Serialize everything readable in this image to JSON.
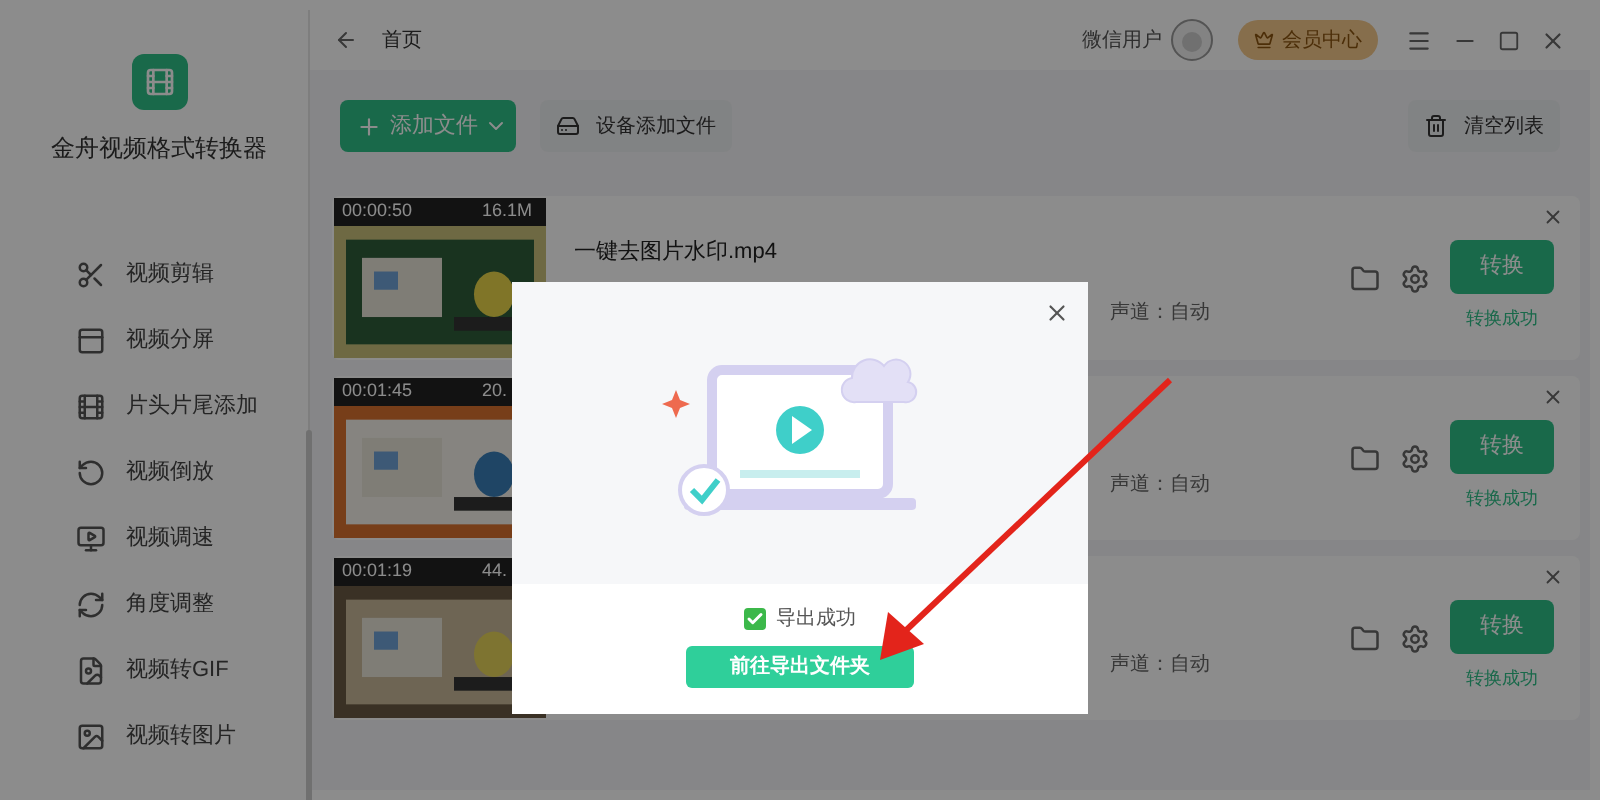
{
  "window": {
    "app_name": "金舟视频格式转换器",
    "breadcrumb": "首页",
    "user": "微信用户",
    "vip_button": "会员中心"
  },
  "sidebar": {
    "items": [
      {
        "label": "视频剪辑"
      },
      {
        "label": "视频分屏"
      },
      {
        "label": "片头片尾添加"
      },
      {
        "label": "视频倒放"
      },
      {
        "label": "视频调速"
      },
      {
        "label": "角度调整"
      },
      {
        "label": "视频转GIF"
      },
      {
        "label": "视频转图片"
      }
    ]
  },
  "toolbar": {
    "add_file": "添加文件",
    "device_add": "设备添加文件",
    "clear_list": "清空列表"
  },
  "files": [
    {
      "name": "一键去图片水印.mp4",
      "duration": "00:00:50",
      "size": "16.1M",
      "params": "声道：自动",
      "convert": "转换",
      "status": "转换成功"
    },
    {
      "duration": "00:01:45",
      "size": "20.",
      "params": "声道：自动",
      "convert": "转换",
      "status": "转换成功"
    },
    {
      "duration": "00:01:19",
      "size": "44.",
      "params": "声道：自动",
      "convert": "转换",
      "status": "转换成功"
    }
  ],
  "dialog": {
    "export_checked": true,
    "export_label": "导出成功",
    "open_folder": "前往导出文件夹"
  }
}
